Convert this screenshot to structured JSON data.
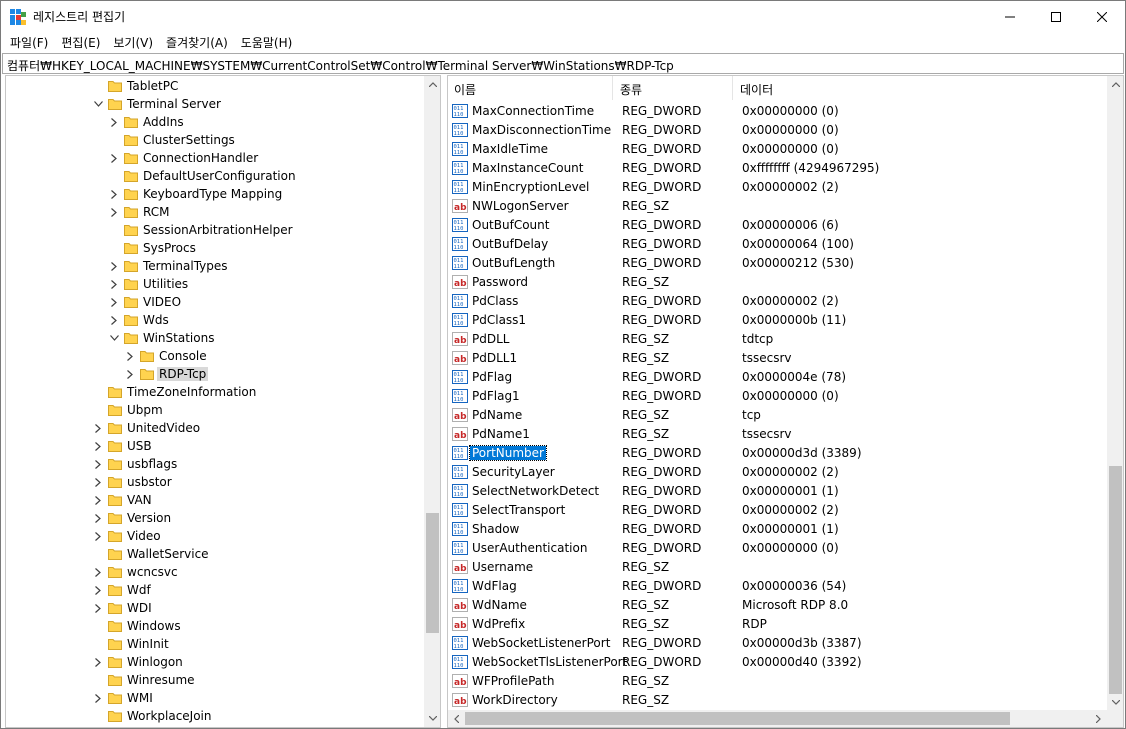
{
  "window": {
    "title": "레지스트리 편집기",
    "menu": [
      "파일(F)",
      "편집(E)",
      "보기(V)",
      "즐겨찾기(A)",
      "도움말(H)"
    ],
    "address": "컴퓨터₩HKEY_LOCAL_MACHINE₩SYSTEM₩CurrentControlSet₩Control₩Terminal Server₩WinStations₩RDP-Tcp"
  },
  "tree": {
    "items": [
      {
        "label": "TabletPC",
        "level": 0,
        "expander": "none"
      },
      {
        "label": "Terminal Server",
        "level": 0,
        "expander": "expanded"
      },
      {
        "label": "AddIns",
        "level": 1,
        "expander": "collapsed"
      },
      {
        "label": "ClusterSettings",
        "level": 1,
        "expander": "none"
      },
      {
        "label": "ConnectionHandler",
        "level": 1,
        "expander": "collapsed"
      },
      {
        "label": "DefaultUserConfiguration",
        "level": 1,
        "expander": "none"
      },
      {
        "label": "KeyboardType Mapping",
        "level": 1,
        "expander": "collapsed"
      },
      {
        "label": "RCM",
        "level": 1,
        "expander": "collapsed"
      },
      {
        "label": "SessionArbitrationHelper",
        "level": 1,
        "expander": "none"
      },
      {
        "label": "SysProcs",
        "level": 1,
        "expander": "none"
      },
      {
        "label": "TerminalTypes",
        "level": 1,
        "expander": "collapsed"
      },
      {
        "label": "Utilities",
        "level": 1,
        "expander": "collapsed"
      },
      {
        "label": "VIDEO",
        "level": 1,
        "expander": "collapsed"
      },
      {
        "label": "Wds",
        "level": 1,
        "expander": "collapsed"
      },
      {
        "label": "WinStations",
        "level": 1,
        "expander": "expanded"
      },
      {
        "label": "Console",
        "level": 2,
        "expander": "collapsed"
      },
      {
        "label": "RDP-Tcp",
        "level": 2,
        "expander": "collapsed",
        "selected": true
      },
      {
        "label": "TimeZoneInformation",
        "level": 0,
        "expander": "none"
      },
      {
        "label": "Ubpm",
        "level": 0,
        "expander": "none"
      },
      {
        "label": "UnitedVideo",
        "level": 0,
        "expander": "collapsed"
      },
      {
        "label": "USB",
        "level": 0,
        "expander": "collapsed"
      },
      {
        "label": "usbflags",
        "level": 0,
        "expander": "collapsed"
      },
      {
        "label": "usbstor",
        "level": 0,
        "expander": "collapsed"
      },
      {
        "label": "VAN",
        "level": 0,
        "expander": "collapsed"
      },
      {
        "label": "Version",
        "level": 0,
        "expander": "collapsed"
      },
      {
        "label": "Video",
        "level": 0,
        "expander": "collapsed"
      },
      {
        "label": "WalletService",
        "level": 0,
        "expander": "none"
      },
      {
        "label": "wcncsvc",
        "level": 0,
        "expander": "collapsed"
      },
      {
        "label": "Wdf",
        "level": 0,
        "expander": "collapsed"
      },
      {
        "label": "WDI",
        "level": 0,
        "expander": "collapsed"
      },
      {
        "label": "Windows",
        "level": 0,
        "expander": "none"
      },
      {
        "label": "WinInit",
        "level": 0,
        "expander": "none"
      },
      {
        "label": "Winlogon",
        "level": 0,
        "expander": "collapsed"
      },
      {
        "label": "Winresume",
        "level": 0,
        "expander": "none"
      },
      {
        "label": "WMI",
        "level": 0,
        "expander": "collapsed"
      },
      {
        "label": "WorkplaceJoin",
        "level": 0,
        "expander": "none"
      }
    ]
  },
  "list": {
    "columns": [
      "이름",
      "종류",
      "데이터"
    ],
    "rows": [
      {
        "name": "MaxConnectionTime",
        "type": "REG_DWORD",
        "data": "0x00000000 (0)",
        "icon": "dword"
      },
      {
        "name": "MaxDisconnectionTime",
        "type": "REG_DWORD",
        "data": "0x00000000 (0)",
        "icon": "dword"
      },
      {
        "name": "MaxIdleTime",
        "type": "REG_DWORD",
        "data": "0x00000000 (0)",
        "icon": "dword"
      },
      {
        "name": "MaxInstanceCount",
        "type": "REG_DWORD",
        "data": "0xffffffff (4294967295)",
        "icon": "dword"
      },
      {
        "name": "MinEncryptionLevel",
        "type": "REG_DWORD",
        "data": "0x00000002 (2)",
        "icon": "dword"
      },
      {
        "name": "NWLogonServer",
        "type": "REG_SZ",
        "data": "",
        "icon": "string"
      },
      {
        "name": "OutBufCount",
        "type": "REG_DWORD",
        "data": "0x00000006 (6)",
        "icon": "dword"
      },
      {
        "name": "OutBufDelay",
        "type": "REG_DWORD",
        "data": "0x00000064 (100)",
        "icon": "dword"
      },
      {
        "name": "OutBufLength",
        "type": "REG_DWORD",
        "data": "0x00000212 (530)",
        "icon": "dword"
      },
      {
        "name": "Password",
        "type": "REG_SZ",
        "data": "",
        "icon": "string"
      },
      {
        "name": "PdClass",
        "type": "REG_DWORD",
        "data": "0x00000002 (2)",
        "icon": "dword"
      },
      {
        "name": "PdClass1",
        "type": "REG_DWORD",
        "data": "0x0000000b (11)",
        "icon": "dword"
      },
      {
        "name": "PdDLL",
        "type": "REG_SZ",
        "data": "tdtcp",
        "icon": "string"
      },
      {
        "name": "PdDLL1",
        "type": "REG_SZ",
        "data": "tssecsrv",
        "icon": "string"
      },
      {
        "name": "PdFlag",
        "type": "REG_DWORD",
        "data": "0x0000004e (78)",
        "icon": "dword"
      },
      {
        "name": "PdFlag1",
        "type": "REG_DWORD",
        "data": "0x00000000 (0)",
        "icon": "dword"
      },
      {
        "name": "PdName",
        "type": "REG_SZ",
        "data": "tcp",
        "icon": "string"
      },
      {
        "name": "PdName1",
        "type": "REG_SZ",
        "data": "tssecsrv",
        "icon": "string"
      },
      {
        "name": "PortNumber",
        "type": "REG_DWORD",
        "data": "0x00000d3d (3389)",
        "icon": "dword",
        "selected": true
      },
      {
        "name": "SecurityLayer",
        "type": "REG_DWORD",
        "data": "0x00000002 (2)",
        "icon": "dword"
      },
      {
        "name": "SelectNetworkDetect",
        "type": "REG_DWORD",
        "data": "0x00000001 (1)",
        "icon": "dword"
      },
      {
        "name": "SelectTransport",
        "type": "REG_DWORD",
        "data": "0x00000002 (2)",
        "icon": "dword"
      },
      {
        "name": "Shadow",
        "type": "REG_DWORD",
        "data": "0x00000001 (1)",
        "icon": "dword"
      },
      {
        "name": "UserAuthentication",
        "type": "REG_DWORD",
        "data": "0x00000000 (0)",
        "icon": "dword"
      },
      {
        "name": "Username",
        "type": "REG_SZ",
        "data": "",
        "icon": "string"
      },
      {
        "name": "WdFlag",
        "type": "REG_DWORD",
        "data": "0x00000036 (54)",
        "icon": "dword"
      },
      {
        "name": "WdName",
        "type": "REG_SZ",
        "data": "Microsoft RDP 8.0",
        "icon": "string"
      },
      {
        "name": "WdPrefix",
        "type": "REG_SZ",
        "data": "RDP",
        "icon": "string"
      },
      {
        "name": "WebSocketListenerPort",
        "type": "REG_DWORD",
        "data": "0x00000d3b (3387)",
        "icon": "dword"
      },
      {
        "name": "WebSocketTlsListenerPort",
        "type": "REG_DWORD",
        "data": "0x00000d40 (3392)",
        "icon": "dword"
      },
      {
        "name": "WFProfilePath",
        "type": "REG_SZ",
        "data": "",
        "icon": "string"
      },
      {
        "name": "WorkDirectory",
        "type": "REG_SZ",
        "data": "",
        "icon": "string"
      }
    ]
  },
  "colors": {
    "selection": "#0078d7",
    "folder": "#ffd34f",
    "tree_selection": "#d9d9d9"
  }
}
